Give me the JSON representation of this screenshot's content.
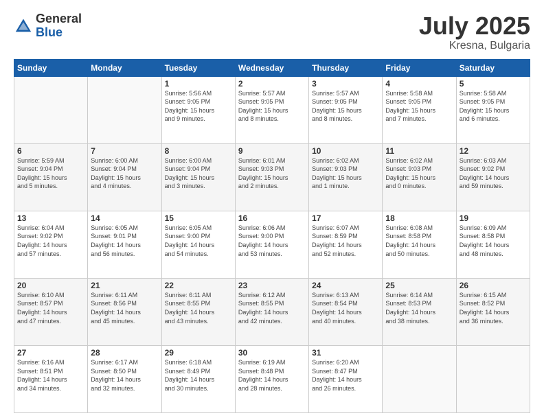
{
  "header": {
    "logo_general": "General",
    "logo_blue": "Blue",
    "title": "July 2025",
    "location": "Kresna, Bulgaria"
  },
  "weekdays": [
    "Sunday",
    "Monday",
    "Tuesday",
    "Wednesday",
    "Thursday",
    "Friday",
    "Saturday"
  ],
  "weeks": [
    [
      {
        "day": "",
        "info": ""
      },
      {
        "day": "",
        "info": ""
      },
      {
        "day": "1",
        "info": "Sunrise: 5:56 AM\nSunset: 9:05 PM\nDaylight: 15 hours\nand 9 minutes."
      },
      {
        "day": "2",
        "info": "Sunrise: 5:57 AM\nSunset: 9:05 PM\nDaylight: 15 hours\nand 8 minutes."
      },
      {
        "day": "3",
        "info": "Sunrise: 5:57 AM\nSunset: 9:05 PM\nDaylight: 15 hours\nand 8 minutes."
      },
      {
        "day": "4",
        "info": "Sunrise: 5:58 AM\nSunset: 9:05 PM\nDaylight: 15 hours\nand 7 minutes."
      },
      {
        "day": "5",
        "info": "Sunrise: 5:58 AM\nSunset: 9:05 PM\nDaylight: 15 hours\nand 6 minutes."
      }
    ],
    [
      {
        "day": "6",
        "info": "Sunrise: 5:59 AM\nSunset: 9:04 PM\nDaylight: 15 hours\nand 5 minutes."
      },
      {
        "day": "7",
        "info": "Sunrise: 6:00 AM\nSunset: 9:04 PM\nDaylight: 15 hours\nand 4 minutes."
      },
      {
        "day": "8",
        "info": "Sunrise: 6:00 AM\nSunset: 9:04 PM\nDaylight: 15 hours\nand 3 minutes."
      },
      {
        "day": "9",
        "info": "Sunrise: 6:01 AM\nSunset: 9:03 PM\nDaylight: 15 hours\nand 2 minutes."
      },
      {
        "day": "10",
        "info": "Sunrise: 6:02 AM\nSunset: 9:03 PM\nDaylight: 15 hours\nand 1 minute."
      },
      {
        "day": "11",
        "info": "Sunrise: 6:02 AM\nSunset: 9:03 PM\nDaylight: 15 hours\nand 0 minutes."
      },
      {
        "day": "12",
        "info": "Sunrise: 6:03 AM\nSunset: 9:02 PM\nDaylight: 14 hours\nand 59 minutes."
      }
    ],
    [
      {
        "day": "13",
        "info": "Sunrise: 6:04 AM\nSunset: 9:02 PM\nDaylight: 14 hours\nand 57 minutes."
      },
      {
        "day": "14",
        "info": "Sunrise: 6:05 AM\nSunset: 9:01 PM\nDaylight: 14 hours\nand 56 minutes."
      },
      {
        "day": "15",
        "info": "Sunrise: 6:05 AM\nSunset: 9:00 PM\nDaylight: 14 hours\nand 54 minutes."
      },
      {
        "day": "16",
        "info": "Sunrise: 6:06 AM\nSunset: 9:00 PM\nDaylight: 14 hours\nand 53 minutes."
      },
      {
        "day": "17",
        "info": "Sunrise: 6:07 AM\nSunset: 8:59 PM\nDaylight: 14 hours\nand 52 minutes."
      },
      {
        "day": "18",
        "info": "Sunrise: 6:08 AM\nSunset: 8:58 PM\nDaylight: 14 hours\nand 50 minutes."
      },
      {
        "day": "19",
        "info": "Sunrise: 6:09 AM\nSunset: 8:58 PM\nDaylight: 14 hours\nand 48 minutes."
      }
    ],
    [
      {
        "day": "20",
        "info": "Sunrise: 6:10 AM\nSunset: 8:57 PM\nDaylight: 14 hours\nand 47 minutes."
      },
      {
        "day": "21",
        "info": "Sunrise: 6:11 AM\nSunset: 8:56 PM\nDaylight: 14 hours\nand 45 minutes."
      },
      {
        "day": "22",
        "info": "Sunrise: 6:11 AM\nSunset: 8:55 PM\nDaylight: 14 hours\nand 43 minutes."
      },
      {
        "day": "23",
        "info": "Sunrise: 6:12 AM\nSunset: 8:55 PM\nDaylight: 14 hours\nand 42 minutes."
      },
      {
        "day": "24",
        "info": "Sunrise: 6:13 AM\nSunset: 8:54 PM\nDaylight: 14 hours\nand 40 minutes."
      },
      {
        "day": "25",
        "info": "Sunrise: 6:14 AM\nSunset: 8:53 PM\nDaylight: 14 hours\nand 38 minutes."
      },
      {
        "day": "26",
        "info": "Sunrise: 6:15 AM\nSunset: 8:52 PM\nDaylight: 14 hours\nand 36 minutes."
      }
    ],
    [
      {
        "day": "27",
        "info": "Sunrise: 6:16 AM\nSunset: 8:51 PM\nDaylight: 14 hours\nand 34 minutes."
      },
      {
        "day": "28",
        "info": "Sunrise: 6:17 AM\nSunset: 8:50 PM\nDaylight: 14 hours\nand 32 minutes."
      },
      {
        "day": "29",
        "info": "Sunrise: 6:18 AM\nSunset: 8:49 PM\nDaylight: 14 hours\nand 30 minutes."
      },
      {
        "day": "30",
        "info": "Sunrise: 6:19 AM\nSunset: 8:48 PM\nDaylight: 14 hours\nand 28 minutes."
      },
      {
        "day": "31",
        "info": "Sunrise: 6:20 AM\nSunset: 8:47 PM\nDaylight: 14 hours\nand 26 minutes."
      },
      {
        "day": "",
        "info": ""
      },
      {
        "day": "",
        "info": ""
      }
    ]
  ]
}
